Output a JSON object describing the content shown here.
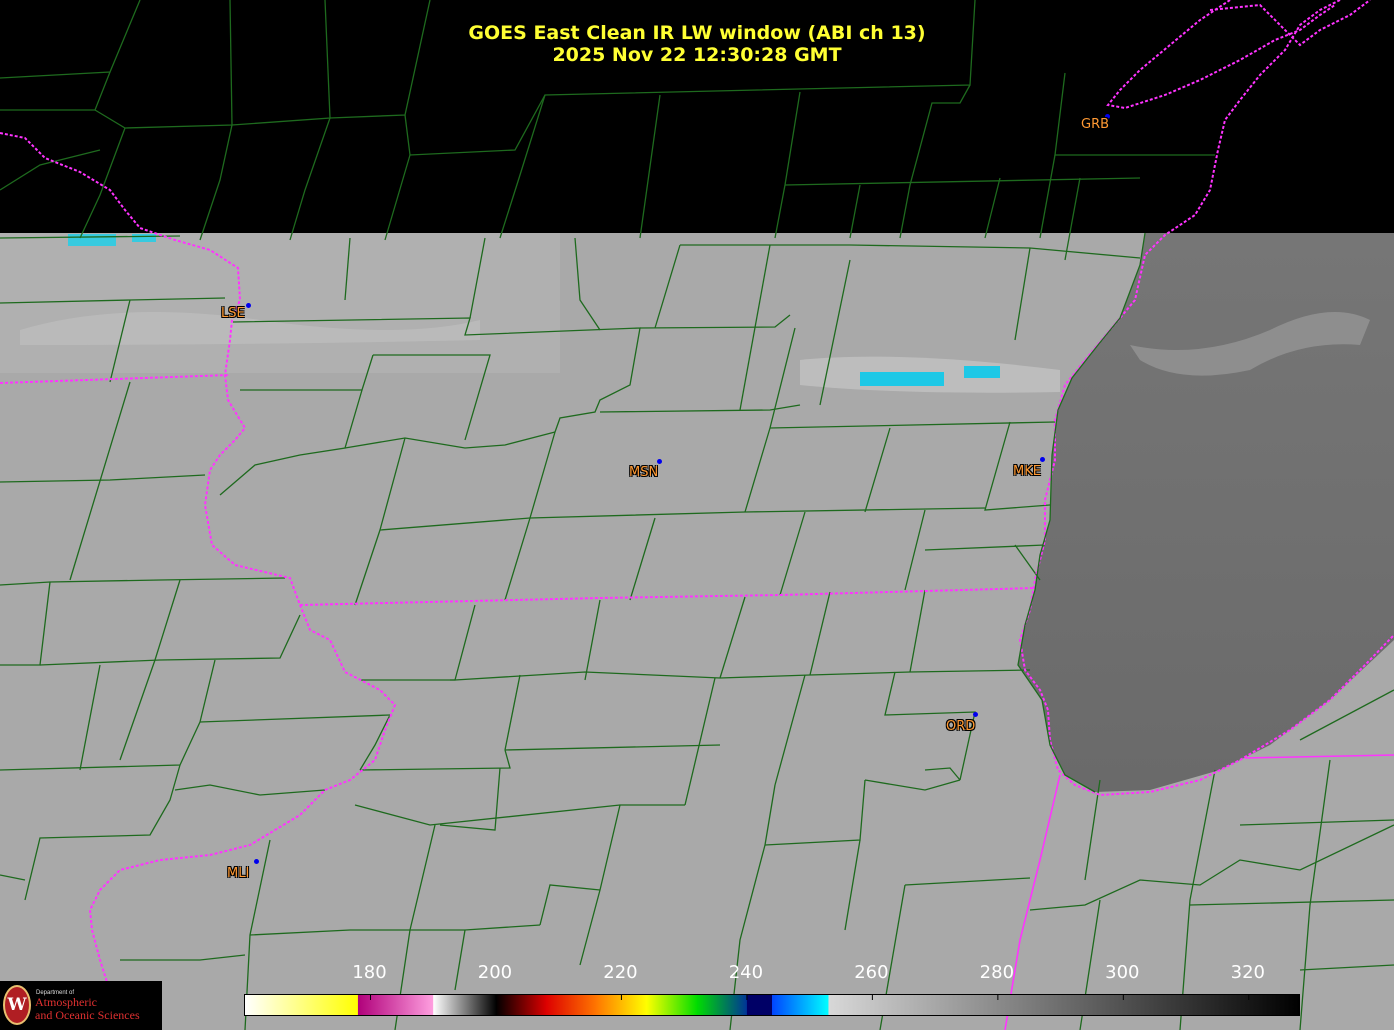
{
  "title": {
    "line1": "GOES East Clean IR LW window (ABI ch 13)",
    "line2": "2025 Nov 22  12:30:28 GMT"
  },
  "colors": {
    "county_lines": "#1e6a1e",
    "state_borders": "#ff33ff",
    "station_label": "#ff9933",
    "station_dot": "#0000ee",
    "title_text": "#ffff33"
  },
  "stations": [
    {
      "id": "GRB"
    },
    {
      "id": "LSE"
    },
    {
      "id": "MSN"
    },
    {
      "id": "MKE"
    },
    {
      "id": "ORD"
    },
    {
      "id": "MLI"
    }
  ],
  "colorbar": {
    "min": 160,
    "max": 328,
    "ticks": [
      "180",
      "200",
      "220",
      "240",
      "260",
      "280",
      "300",
      "320"
    ],
    "tick_values": [
      180,
      200,
      220,
      240,
      260,
      280,
      300,
      320
    ]
  },
  "logo": {
    "small": "Department of",
    "line1": "Atmospheric",
    "line2": "and Oceanic Sciences",
    "shield": "W"
  }
}
